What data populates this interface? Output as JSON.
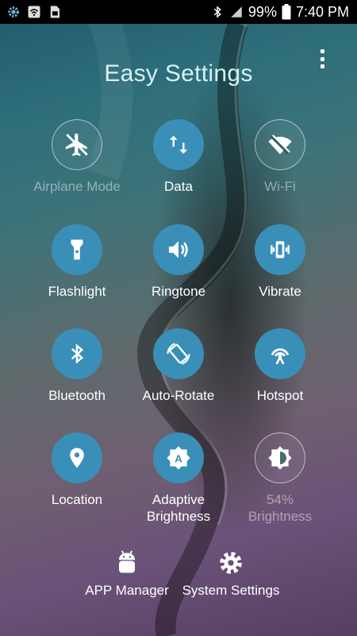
{
  "status_bar": {
    "battery": "99%",
    "time": "7:40 PM"
  },
  "title": "Easy Settings",
  "toggles": [
    {
      "label": "Airplane Mode",
      "state": "off",
      "icon": "airplane-icon"
    },
    {
      "label": "Data",
      "state": "on",
      "icon": "data-transfer-icon"
    },
    {
      "label": "Wi-Fi",
      "state": "off",
      "icon": "wifi-off-icon"
    },
    {
      "label": "Flashlight",
      "state": "on",
      "icon": "flashlight-icon"
    },
    {
      "label": "Ringtone",
      "state": "on",
      "icon": "speaker-icon"
    },
    {
      "label": "Vibrate",
      "state": "on",
      "icon": "vibrate-icon"
    },
    {
      "label": "Bluetooth",
      "state": "on",
      "icon": "bluetooth-icon"
    },
    {
      "label": "Auto-Rotate",
      "state": "on",
      "icon": "rotate-icon"
    },
    {
      "label": "Hotspot",
      "state": "on",
      "icon": "hotspot-icon"
    },
    {
      "label": "Location",
      "state": "on",
      "icon": "location-pin-icon"
    },
    {
      "label_line1": "Adaptive",
      "label_line2": "Brightness",
      "state": "on",
      "icon": "adaptive-brightness-icon"
    },
    {
      "label_line1": "54%",
      "label_line2": "Brightness",
      "state": "off",
      "icon": "brightness-icon"
    }
  ],
  "bottom": {
    "app_manager": "APP Manager",
    "system_settings": "System Settings"
  },
  "colors": {
    "accent": "#3a8fb8",
    "title": "#d6f1f6"
  }
}
